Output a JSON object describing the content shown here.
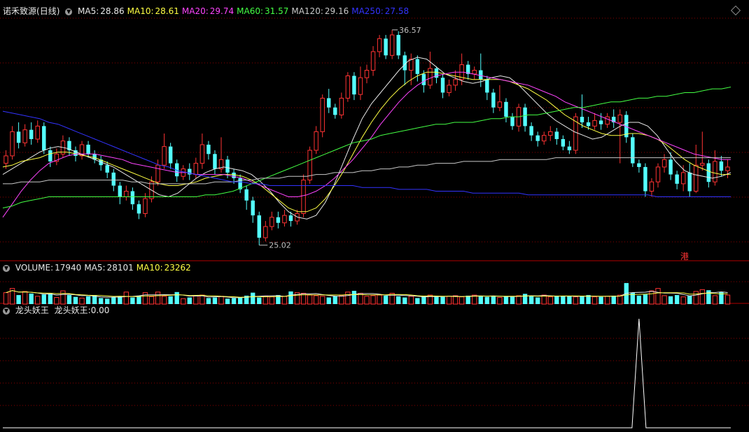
{
  "header": {
    "stock_name": "诺禾致源",
    "period": "(日线)",
    "ma_items": [
      {
        "label": "MA5:",
        "value": "28.86",
        "color": "#e8e8e8"
      },
      {
        "label": "MA10:",
        "value": "28.61",
        "color": "#ffff44"
      },
      {
        "label": "MA20:",
        "value": "29.74",
        "color": "#ff44ff"
      },
      {
        "label": "MA60:",
        "value": "31.57",
        "color": "#44ff44"
      },
      {
        "label": "MA120:",
        "value": "29.16",
        "color": "#c8c8c8"
      },
      {
        "label": "MA250:",
        "value": "27.58",
        "color": "#3333ff"
      }
    ]
  },
  "volume_header": {
    "items": [
      {
        "label": "VOLUME:",
        "value": "17940",
        "color": "#e8e8e8"
      },
      {
        "label": "MA5:",
        "value": "28101",
        "color": "#e8e8e8"
      },
      {
        "label": "MA10:",
        "value": "23262",
        "color": "#ffff44"
      }
    ]
  },
  "indicator_header": {
    "name": "龙头妖王",
    "label": "龙头妖王:",
    "value": "0.00"
  },
  "badge": "港",
  "chart_data": {
    "type": "candlestick",
    "price_range": [
      25.02,
      36.57
    ],
    "max_label": "36.57",
    "min_label": "25.02",
    "colors": {
      "up": "#ff3333",
      "down": "#54ffff",
      "grid": "#8b0000"
    },
    "candles": [
      [
        29.4,
        29.8,
        29.1,
        30.1
      ],
      [
        29.8,
        31.1,
        29.6,
        31.4
      ],
      [
        31.1,
        30.5,
        30.2,
        31.6
      ],
      [
        30.5,
        31.2,
        30.3,
        31.5
      ],
      [
        31.2,
        30.7,
        30.4,
        31.6
      ],
      [
        30.7,
        31.4,
        30.5,
        31.7
      ],
      [
        31.4,
        30.1,
        29.9,
        31.6
      ],
      [
        30.1,
        29.5,
        29.2,
        30.3
      ],
      [
        29.5,
        29.9,
        29.3,
        30.2
      ],
      [
        29.9,
        30.6,
        29.7,
        30.9
      ],
      [
        30.6,
        30.1,
        29.8,
        30.8
      ],
      [
        30.1,
        29.8,
        29.5,
        30.3
      ],
      [
        29.8,
        30.4,
        29.6,
        30.6
      ],
      [
        30.4,
        29.9,
        29.7,
        30.6
      ],
      [
        29.9,
        29.6,
        29.4,
        30.1
      ],
      [
        29.6,
        29.3,
        29.0,
        29.8
      ],
      [
        29.3,
        28.9,
        28.6,
        29.5
      ],
      [
        28.9,
        28.2,
        27.9,
        29.1
      ],
      [
        28.2,
        27.6,
        27.2,
        28.4
      ],
      [
        27.6,
        27.9,
        27.4,
        28.2
      ],
      [
        27.9,
        27.2,
        26.9,
        28.1
      ],
      [
        27.2,
        26.7,
        26.4,
        27.4
      ],
      [
        26.7,
        27.5,
        26.5,
        27.8
      ],
      [
        27.5,
        28.4,
        27.3,
        28.7
      ],
      [
        28.4,
        29.3,
        28.2,
        29.6
      ],
      [
        29.3,
        30.3,
        29.1,
        31.0
      ],
      [
        30.3,
        29.4,
        29.1,
        30.5
      ],
      [
        29.4,
        28.7,
        28.4,
        29.6
      ],
      [
        28.7,
        29.1,
        28.5,
        29.3
      ],
      [
        29.1,
        28.8,
        28.5,
        29.4
      ],
      [
        28.8,
        29.4,
        28.6,
        29.7
      ],
      [
        29.4,
        30.4,
        29.1,
        31.0
      ],
      [
        30.4,
        29.9,
        29.6,
        30.6
      ],
      [
        29.9,
        29.1,
        28.8,
        30.1
      ],
      [
        29.1,
        29.6,
        28.9,
        30.8
      ],
      [
        29.6,
        28.9,
        28.6,
        29.8
      ],
      [
        28.9,
        28.6,
        28.3,
        29.1
      ],
      [
        28.6,
        28.0,
        27.8,
        28.8
      ],
      [
        28.0,
        27.4,
        26.9,
        28.2
      ],
      [
        27.4,
        26.6,
        26.2,
        27.6
      ],
      [
        26.6,
        25.4,
        25.0,
        26.8
      ],
      [
        25.4,
        26.0,
        25.2,
        26.3
      ],
      [
        26.0,
        26.5,
        25.8,
        26.8
      ],
      [
        26.5,
        26.2,
        25.9,
        26.8
      ],
      [
        26.2,
        26.6,
        26.0,
        26.9
      ],
      [
        26.6,
        26.3,
        26.0,
        26.8
      ],
      [
        26.3,
        26.7,
        26.1,
        26.9
      ],
      [
        26.7,
        28.5,
        26.5,
        28.8
      ],
      [
        28.5,
        30.1,
        28.3,
        30.3
      ],
      [
        30.1,
        31.1,
        29.9,
        31.4
      ],
      [
        31.1,
        32.9,
        30.8,
        33.1
      ],
      [
        32.9,
        32.4,
        32.1,
        33.4
      ],
      [
        32.4,
        32.0,
        31.8,
        32.6
      ],
      [
        32.0,
        32.9,
        31.8,
        33.2
      ],
      [
        32.9,
        34.1,
        32.7,
        34.3
      ],
      [
        34.1,
        33.1,
        32.8,
        34.3
      ],
      [
        33.1,
        34.0,
        32.8,
        34.6
      ],
      [
        34.0,
        34.4,
        33.7,
        34.7
      ],
      [
        34.4,
        35.4,
        34.1,
        35.7
      ],
      [
        35.4,
        36.1,
        35.1,
        36.3
      ],
      [
        36.1,
        35.2,
        35.0,
        36.3
      ],
      [
        35.2,
        36.3,
        35.0,
        36.57
      ],
      [
        36.3,
        35.2,
        35.0,
        36.5
      ],
      [
        35.2,
        34.4,
        33.6,
        35.4
      ],
      [
        34.4,
        35.0,
        33.6,
        35.3
      ],
      [
        35.0,
        34.2,
        33.8,
        35.2
      ],
      [
        34.2,
        33.6,
        33.2,
        34.4
      ],
      [
        33.6,
        34.5,
        33.4,
        35.4
      ],
      [
        34.5,
        34.0,
        33.7,
        34.6
      ],
      [
        34.0,
        33.2,
        32.9,
        34.2
      ],
      [
        33.2,
        33.6,
        33.0,
        33.9
      ],
      [
        33.6,
        33.9,
        33.3,
        34.4
      ],
      [
        33.9,
        34.7,
        33.6,
        35.3
      ],
      [
        34.7,
        34.2,
        33.9,
        34.9
      ],
      [
        34.2,
        34.4,
        33.9,
        34.6
      ],
      [
        34.4,
        33.9,
        33.5,
        35.3
      ],
      [
        33.9,
        33.2,
        32.8,
        34.1
      ],
      [
        33.2,
        32.4,
        32.1,
        33.4
      ],
      [
        32.4,
        32.7,
        32.2,
        33.6
      ],
      [
        32.7,
        31.9,
        31.6,
        32.9
      ],
      [
        31.9,
        31.4,
        31.2,
        32.1
      ],
      [
        31.4,
        32.4,
        31.1,
        32.6
      ],
      [
        32.4,
        31.4,
        31.1,
        32.6
      ],
      [
        31.4,
        30.9,
        30.6,
        31.6
      ],
      [
        30.9,
        30.6,
        30.3,
        31.1
      ],
      [
        30.6,
        30.9,
        30.4,
        31.1
      ],
      [
        30.9,
        31.1,
        30.6,
        31.4
      ],
      [
        31.1,
        30.7,
        30.4,
        31.3
      ],
      [
        30.7,
        30.3,
        30.1,
        30.9
      ],
      [
        30.3,
        30.1,
        29.9,
        30.6
      ],
      [
        30.1,
        31.9,
        29.9,
        32.1
      ],
      [
        31.9,
        31.6,
        31.3,
        33.1
      ],
      [
        31.6,
        31.4,
        31.2,
        31.9
      ],
      [
        31.4,
        31.7,
        31.2,
        32.1
      ],
      [
        31.7,
        31.5,
        31.2,
        32.1
      ],
      [
        31.5,
        31.9,
        31.3,
        32.1
      ],
      [
        31.9,
        31.6,
        31.3,
        32.3
      ],
      [
        31.6,
        32.0,
        29.4,
        32.3
      ],
      [
        32.0,
        30.8,
        30.5,
        32.2
      ],
      [
        30.8,
        29.4,
        29.2,
        31.0
      ],
      [
        29.4,
        29.2,
        28.9,
        29.6
      ],
      [
        29.2,
        27.9,
        27.6,
        29.4
      ],
      [
        27.9,
        28.4,
        27.6,
        28.6
      ],
      [
        28.4,
        29.2,
        28.1,
        29.4
      ],
      [
        29.2,
        29.6,
        28.9,
        29.9
      ],
      [
        29.6,
        28.8,
        28.5,
        30.0
      ],
      [
        28.8,
        28.3,
        28.0,
        29.0
      ],
      [
        28.3,
        28.9,
        27.9,
        29.3
      ],
      [
        28.9,
        27.9,
        27.6,
        29.4
      ],
      [
        27.9,
        29.3,
        27.8,
        30.4
      ],
      [
        29.3,
        29.4,
        29.0,
        31.1
      ],
      [
        29.4,
        28.4,
        28.1,
        29.6
      ],
      [
        28.4,
        29.5,
        28.2,
        30.1
      ],
      [
        29.5,
        29.0,
        28.7,
        29.8
      ],
      [
        29.0,
        29.2,
        28.6,
        29.6
      ]
    ],
    "ma_series": [
      {
        "name": "MA5",
        "color": "#e8e8e8",
        "values": [
          28.8,
          29.1,
          29.4,
          29.7,
          30.0,
          30.2,
          30.3,
          30.2,
          30.0,
          29.8,
          29.6,
          29.4,
          29.2,
          28.9,
          28.6,
          28.3,
          28.0,
          27.7,
          27.6,
          27.8,
          28.2,
          28.6,
          28.9,
          29.1,
          29.2,
          29.1,
          29.0,
          28.8,
          28.4,
          27.9,
          27.3,
          26.8,
          26.5,
          26.4,
          26.6,
          27.3,
          28.3,
          29.5,
          30.7,
          31.8,
          32.6,
          33.2,
          33.8,
          34.4,
          34.9,
          35.1,
          35.0,
          34.6,
          34.2,
          34.0,
          33.8,
          33.7,
          33.8,
          34.0,
          34.1,
          34.0,
          33.6,
          33.1,
          32.6,
          32.1,
          31.7,
          31.4,
          31.1,
          30.9,
          30.7,
          30.8,
          31.1,
          31.4,
          31.6,
          31.6,
          31.4,
          30.9,
          30.2,
          29.5,
          29.0,
          28.8,
          28.7,
          28.6,
          28.7,
          28.9
        ]
      },
      {
        "name": "MA10",
        "color": "#ffff44",
        "values": [
          29.2,
          29.3,
          29.5,
          29.6,
          29.7,
          29.9,
          30.0,
          30.0,
          29.9,
          29.8,
          29.7,
          29.5,
          29.3,
          29.1,
          28.9,
          28.7,
          28.5,
          28.3,
          28.2,
          28.2,
          28.3,
          28.4,
          28.6,
          28.7,
          28.8,
          28.8,
          28.7,
          28.5,
          28.2,
          27.8,
          27.4,
          27.0,
          26.8,
          26.8,
          27.0,
          27.5,
          28.2,
          29.0,
          29.9,
          30.8,
          31.6,
          32.3,
          32.9,
          33.4,
          33.8,
          34.1,
          34.3,
          34.3,
          34.2,
          34.1,
          34.0,
          33.9,
          33.9,
          33.9,
          33.9,
          33.8,
          33.6,
          33.4,
          33.1,
          32.8,
          32.4,
          32.0,
          31.7,
          31.4,
          31.2,
          31.0,
          30.9,
          30.9,
          31.0,
          31.0,
          30.9,
          30.7,
          30.4,
          30.0,
          29.6,
          29.3,
          29.1,
          28.9,
          28.8,
          28.8
        ]
      },
      {
        "name": "MA20",
        "color": "#ff44ff",
        "values": [
          26.5,
          27.2,
          27.9,
          28.5,
          29.0,
          29.4,
          29.6,
          29.8,
          29.9,
          29.9,
          29.9,
          29.8,
          29.7,
          29.6,
          29.4,
          29.3,
          29.2,
          29.1,
          29.0,
          28.9,
          28.9,
          28.8,
          28.8,
          28.8,
          28.8,
          28.7,
          28.6,
          28.4,
          28.2,
          28.0,
          27.8,
          27.6,
          27.6,
          27.7,
          27.9,
          28.2,
          28.6,
          29.1,
          29.6,
          30.2,
          30.8,
          31.5,
          32.1,
          32.7,
          33.2,
          33.6,
          33.9,
          34.1,
          34.2,
          34.3,
          34.3,
          34.2,
          34.1,
          34.0,
          33.9,
          33.8,
          33.7,
          33.6,
          33.4,
          33.2,
          33.0,
          32.7,
          32.5,
          32.3,
          32.1,
          31.9,
          31.7,
          31.5,
          31.3,
          31.1,
          30.9,
          30.7,
          30.5,
          30.3,
          30.1,
          29.9,
          29.8,
          29.7,
          29.6,
          29.6
        ]
      },
      {
        "name": "MA60",
        "color": "#44ff44",
        "values": [
          27.0,
          27.1,
          27.3,
          27.4,
          27.5,
          27.6,
          27.6,
          27.6,
          27.6,
          27.6,
          27.6,
          27.6,
          27.6,
          27.6,
          27.6,
          27.6,
          27.6,
          27.6,
          27.6,
          27.6,
          27.6,
          27.6,
          27.7,
          27.7,
          27.8,
          27.9,
          28.1,
          28.3,
          28.5,
          28.7,
          28.9,
          29.1,
          29.3,
          29.5,
          29.7,
          29.9,
          30.1,
          30.3,
          30.5,
          30.6,
          30.7,
          30.9,
          31.0,
          31.1,
          31.2,
          31.3,
          31.4,
          31.5,
          31.5,
          31.6,
          31.6,
          31.6,
          31.7,
          31.8,
          31.8,
          31.9,
          31.9,
          32.0,
          32.0,
          32.1,
          32.2,
          32.3,
          32.4,
          32.4,
          32.5,
          32.6,
          32.7,
          32.7,
          32.8,
          32.9,
          32.9,
          33.0,
          33.0,
          33.1,
          33.2,
          33.2,
          33.3,
          33.4,
          33.4,
          33.5
        ]
      },
      {
        "name": "MA120",
        "color": "#c8c8c8",
        "values": [
          28.3,
          28.3,
          28.4,
          28.4,
          28.4,
          28.5,
          28.5,
          28.5,
          28.5,
          28.5,
          28.5,
          28.5,
          28.5,
          28.5,
          28.4,
          28.4,
          28.3,
          28.3,
          28.3,
          28.3,
          28.3,
          28.3,
          28.3,
          28.4,
          28.4,
          28.4,
          28.5,
          28.5,
          28.6,
          28.6,
          28.6,
          28.7,
          28.7,
          28.7,
          28.8,
          28.8,
          28.9,
          28.9,
          28.9,
          29.0,
          29.0,
          29.1,
          29.1,
          29.2,
          29.2,
          29.3,
          29.3,
          29.4,
          29.4,
          29.4,
          29.5,
          29.5,
          29.5,
          29.5,
          29.6,
          29.6,
          29.6,
          29.6,
          29.6,
          29.6,
          29.7,
          29.7,
          29.7,
          29.7,
          29.7,
          29.7,
          29.7,
          29.7,
          29.7,
          29.7,
          29.7,
          29.7,
          29.7,
          29.7,
          29.7,
          29.7,
          29.7,
          29.7,
          29.7,
          29.7
        ]
      },
      {
        "name": "MA250",
        "color": "#3333ff",
        "values": [
          32.2,
          32.1,
          32.0,
          31.9,
          31.8,
          31.6,
          31.5,
          31.3,
          31.1,
          30.9,
          30.7,
          30.5,
          30.3,
          30.1,
          29.9,
          29.7,
          29.5,
          29.3,
          29.2,
          29.0,
          28.9,
          28.8,
          28.7,
          28.6,
          28.5,
          28.4,
          28.4,
          28.3,
          28.3,
          28.2,
          28.2,
          28.2,
          28.2,
          28.2,
          28.2,
          28.2,
          28.2,
          28.2,
          28.2,
          28.1,
          28.1,
          28.1,
          28.1,
          28.0,
          28.0,
          28.0,
          28.0,
          27.9,
          27.9,
          27.9,
          27.9,
          27.8,
          27.8,
          27.8,
          27.8,
          27.8,
          27.8,
          27.7,
          27.7,
          27.7,
          27.7,
          27.7,
          27.7,
          27.7,
          27.7,
          27.7,
          27.7,
          27.7,
          27.7,
          27.7,
          27.7,
          27.6,
          27.6,
          27.6,
          27.6,
          27.6,
          27.6,
          27.6,
          27.6,
          27.6
        ]
      }
    ],
    "volume": {
      "max": 100,
      "values": [
        38,
        52,
        30,
        42,
        35,
        26,
        32,
        35,
        22,
        44,
        30,
        24,
        20,
        26,
        30,
        20,
        18,
        22,
        26,
        40,
        22,
        28,
        38,
        25,
        40,
        26,
        26,
        40,
        18,
        22,
        28,
        30,
        20,
        22,
        26,
        18,
        20,
        22,
        28,
        38,
        22,
        26,
        24,
        30,
        26,
        42,
        38,
        36,
        30,
        28,
        26,
        22,
        26,
        28,
        40,
        44,
        36,
        26,
        28,
        30,
        28,
        36,
        26,
        22,
        26,
        20,
        26,
        30,
        24,
        24,
        26,
        28,
        24,
        28,
        30,
        26,
        24,
        28,
        22,
        26,
        24,
        28,
        34,
        28,
        22,
        30,
        24,
        28,
        26,
        26,
        24,
        26,
        30,
        24,
        24,
        26,
        28,
        30,
        70,
        38,
        28,
        32,
        44,
        52,
        28,
        26,
        30,
        24,
        28,
        42,
        48,
        46,
        28,
        40,
        30
      ],
      "ma_series": [
        {
          "name": "MA5",
          "color": "#e8e8e8"
        },
        {
          "name": "MA10",
          "color": "#ffff44"
        }
      ]
    },
    "indicator": {
      "name": "龙头妖王",
      "values_note": "zero except a spike",
      "spike_index": 100,
      "spike_value": 1
    }
  }
}
